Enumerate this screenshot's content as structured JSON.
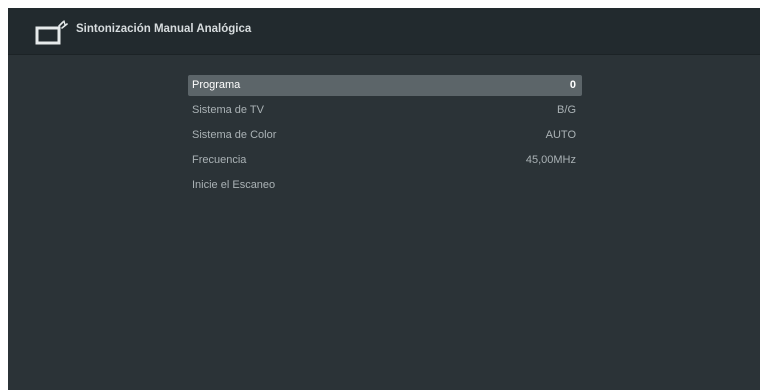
{
  "header": {
    "title": "Sintonización Manual Analógica",
    "icon": "tv-antenna-icon"
  },
  "menu": {
    "items": [
      {
        "label": "Programa",
        "value": "0",
        "selected": true
      },
      {
        "label": "Sistema de TV",
        "value": "B/G",
        "selected": false
      },
      {
        "label": "Sistema de Color",
        "value": "AUTO",
        "selected": false
      },
      {
        "label": "Frecuencia",
        "value": "45,00MHz",
        "selected": false
      },
      {
        "label": "Inicie el Escaneo",
        "value": "",
        "selected": false
      }
    ]
  },
  "colors": {
    "background": "#2b3337",
    "header": "#222a2e",
    "selection": "#5c6569",
    "text": "#aab2b5"
  }
}
